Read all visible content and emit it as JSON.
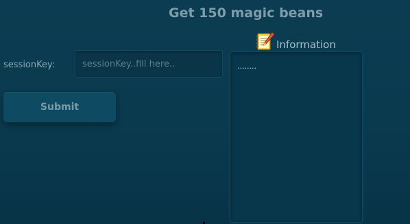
{
  "page": {
    "title": "Get 150 magic beans"
  },
  "form": {
    "session_label": "sessionKey:",
    "session_placeholder": "sessionKey..fill here..",
    "session_value": "",
    "submit_label": "Submit"
  },
  "info": {
    "icon": "notepad-icon",
    "label": "Information",
    "content": "........"
  },
  "colors": {
    "background": "#0b3c51",
    "title": "#7e9ca9",
    "input_bg": "#0a3549",
    "button_bg": "#0e4b62"
  }
}
